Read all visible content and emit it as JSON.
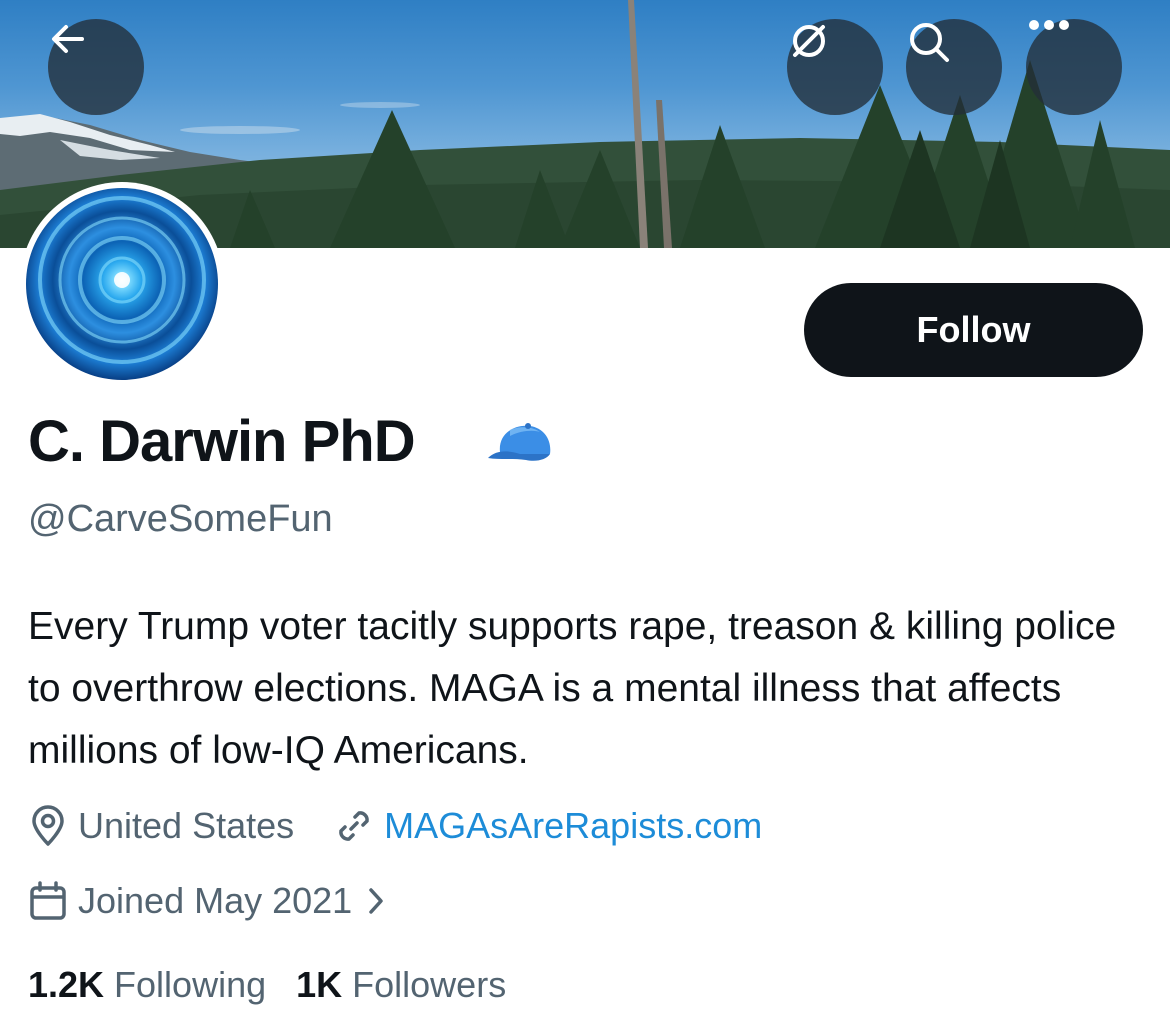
{
  "banner": {
    "back_icon": "arrow-left-icon",
    "translate_icon": "slashed-circle-icon",
    "search_icon": "search-icon",
    "more_icon": "more-horizontal-icon"
  },
  "profile": {
    "display_name": "C. Darwin PhD",
    "badge_icon": "blue-cap-icon",
    "handle": "@CarveSomeFun",
    "bio": "Every Trump voter tacitly supports rape, treason & killing police to overthrow elections. MAGA is a mental illness that affects millions of low-IQ Americans.",
    "location": "United States",
    "website": "MAGAsAreRapists.com",
    "joined": "Joined May 2021",
    "follow_label": "Follow"
  },
  "stats": {
    "following_count": "1.2K",
    "following_label": "Following",
    "followers_count": "1K",
    "followers_label": "Followers"
  }
}
